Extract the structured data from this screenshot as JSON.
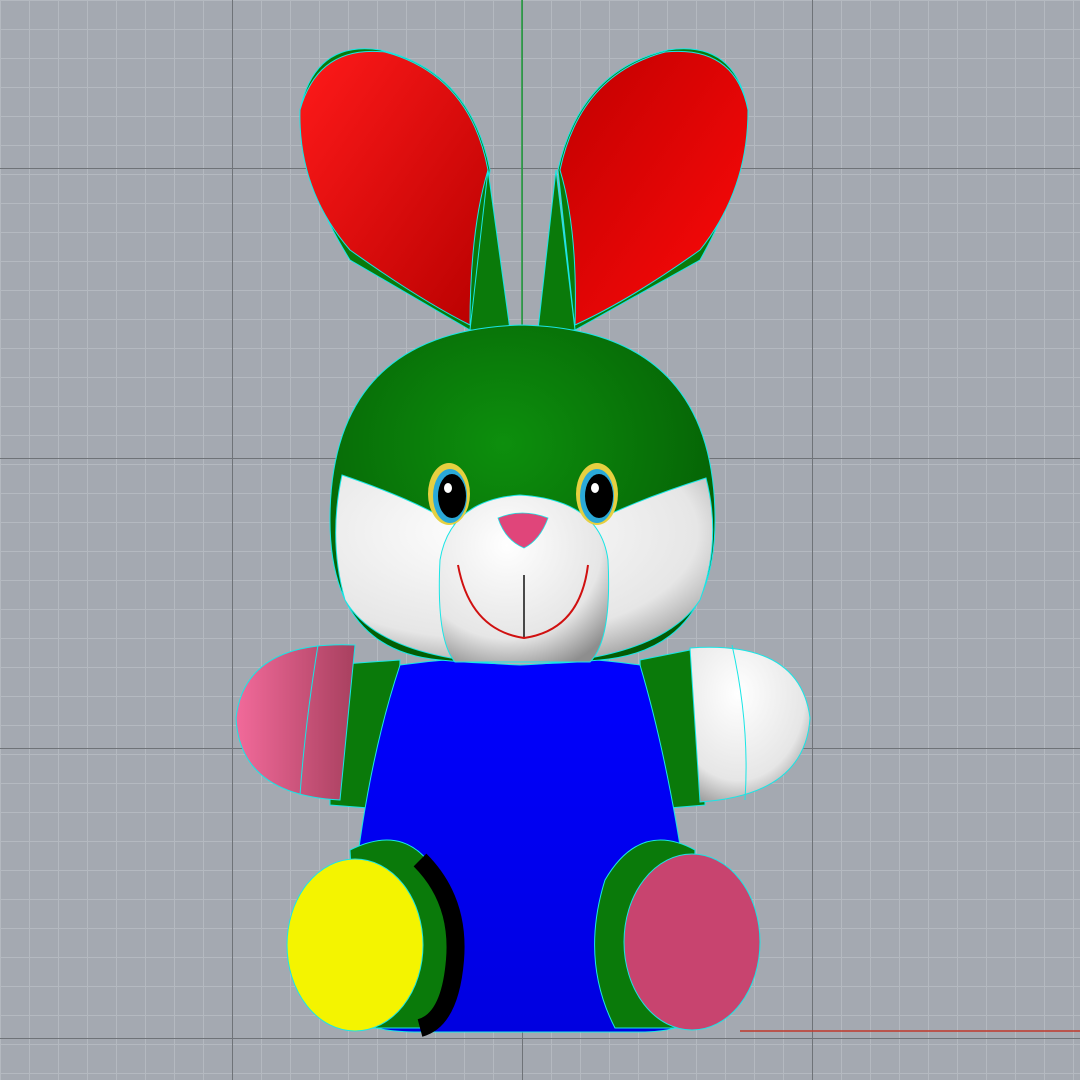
{
  "viewport": {
    "view": "front",
    "display_mode": "shaded",
    "grid": true,
    "axes": {
      "x_axis_color": "#c0392b",
      "y_axis_color": "#1f9e3a"
    }
  },
  "model": {
    "subject": "toy bunny",
    "edge_color": "#19e6e6",
    "colors": {
      "ears_inner": "#e00000",
      "head_and_limbs": "#0a7a0a",
      "face_and_muzzle": "#ffffff",
      "body": "#0000ff",
      "nose": "#e0457a",
      "left_hand": "#c8446f",
      "right_hand": "#f2f2f2",
      "left_foot": "#f4f400",
      "right_foot": "#c8446f",
      "eye_ring": "#2aa9d8",
      "eye_outer_ring": "#e6d040",
      "mouth": "#d01010"
    }
  }
}
